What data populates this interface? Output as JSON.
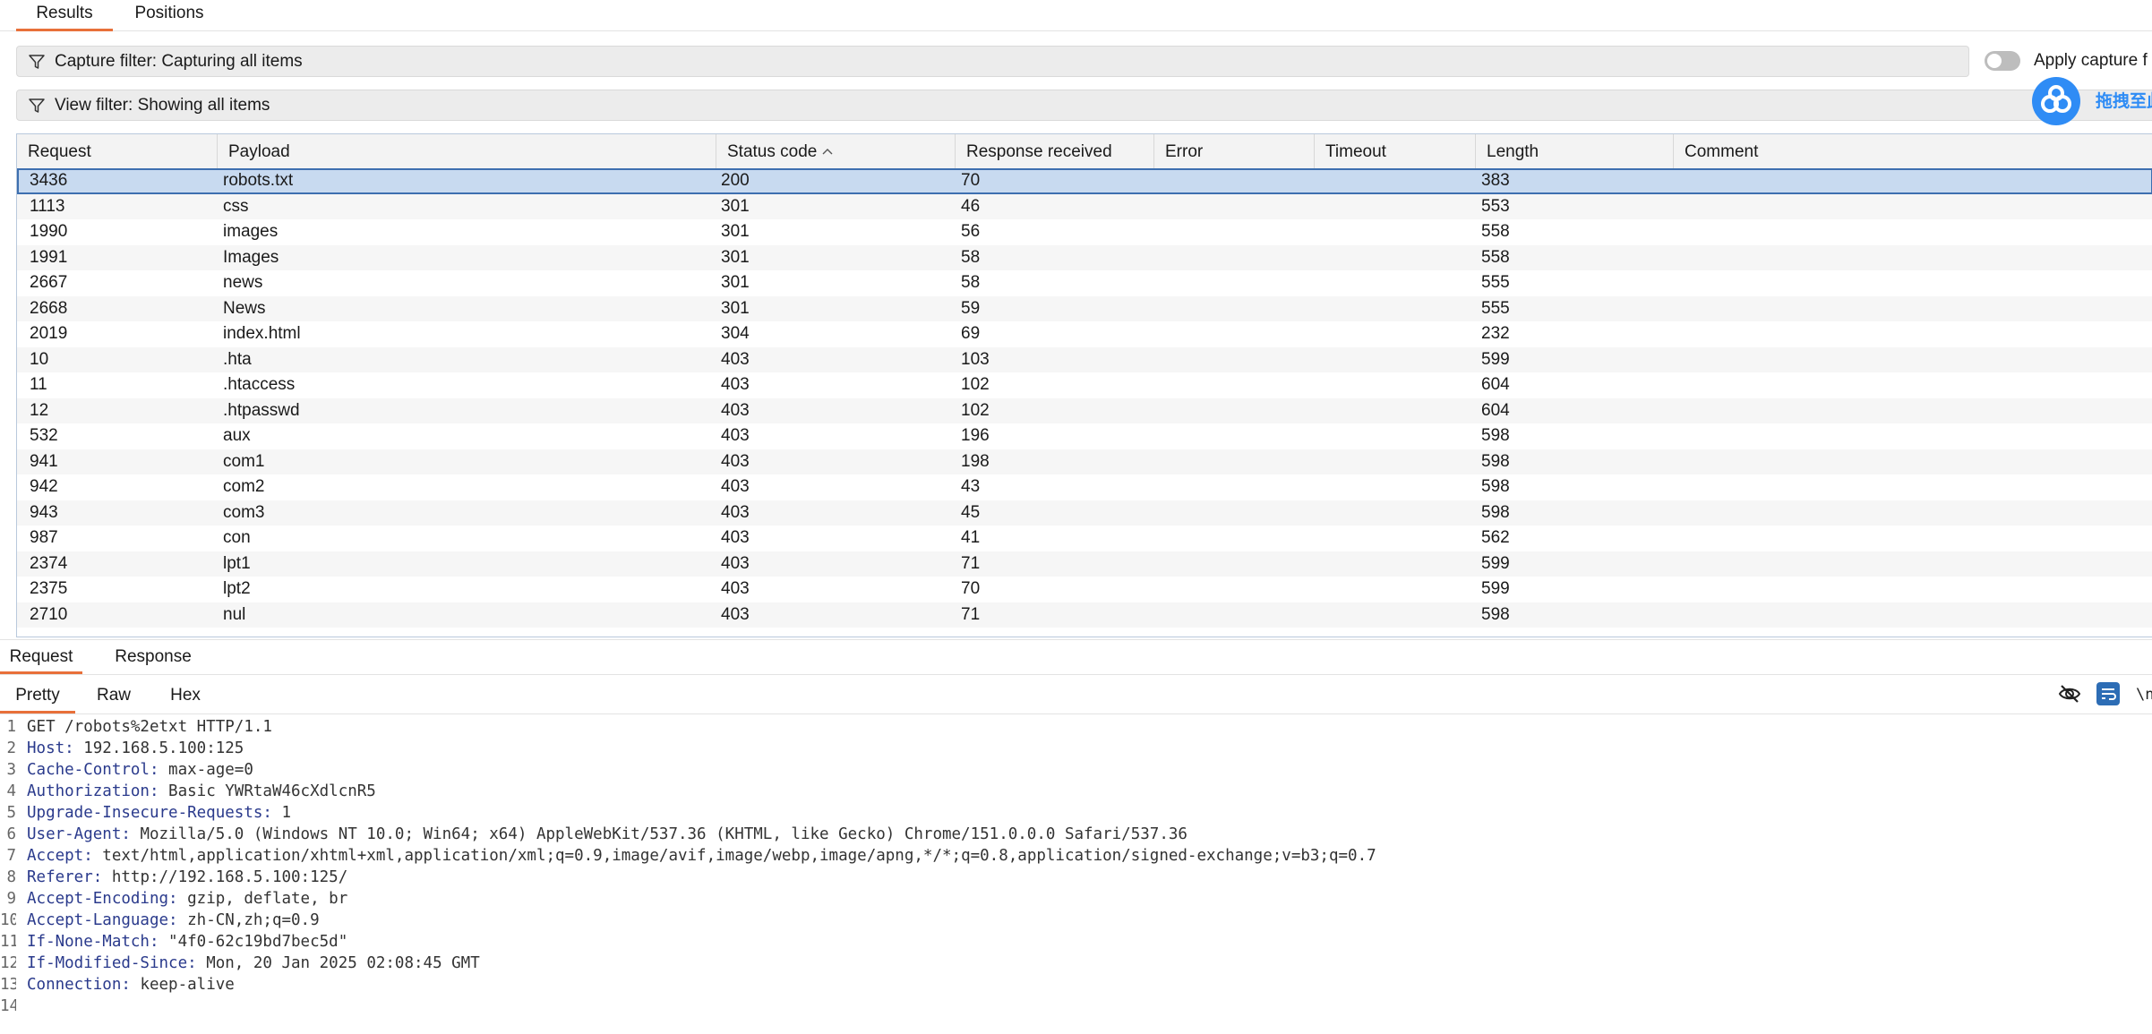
{
  "top_tabs": [
    "Results",
    "Positions"
  ],
  "capture_filter": "Capture filter: Capturing all items",
  "view_filter": "View filter: Showing all items",
  "apply_capture_label": "Apply capture f",
  "baidu_overlay_text": "拖拽至此",
  "table": {
    "columns": [
      "Request",
      "Payload",
      "Status code",
      "Response received",
      "Error",
      "Timeout",
      "Length",
      "Comment"
    ],
    "sorted_column": "Status code",
    "sort_direction": "ascending",
    "rows": [
      {
        "request": "3436",
        "payload": "robots.txt",
        "status": "200",
        "received": "70",
        "error": "",
        "timeout": "",
        "length": "383",
        "comment": "",
        "selected": true
      },
      {
        "request": "1113",
        "payload": "css",
        "status": "301",
        "received": "46",
        "error": "",
        "timeout": "",
        "length": "553",
        "comment": ""
      },
      {
        "request": "1990",
        "payload": "images",
        "status": "301",
        "received": "56",
        "error": "",
        "timeout": "",
        "length": "558",
        "comment": ""
      },
      {
        "request": "1991",
        "payload": "Images",
        "status": "301",
        "received": "58",
        "error": "",
        "timeout": "",
        "length": "558",
        "comment": ""
      },
      {
        "request": "2667",
        "payload": "news",
        "status": "301",
        "received": "58",
        "error": "",
        "timeout": "",
        "length": "555",
        "comment": ""
      },
      {
        "request": "2668",
        "payload": "News",
        "status": "301",
        "received": "59",
        "error": "",
        "timeout": "",
        "length": "555",
        "comment": ""
      },
      {
        "request": "2019",
        "payload": "index.html",
        "status": "304",
        "received": "69",
        "error": "",
        "timeout": "",
        "length": "232",
        "comment": ""
      },
      {
        "request": "10",
        "payload": ".hta",
        "status": "403",
        "received": "103",
        "error": "",
        "timeout": "",
        "length": "599",
        "comment": ""
      },
      {
        "request": "11",
        "payload": ".htaccess",
        "status": "403",
        "received": "102",
        "error": "",
        "timeout": "",
        "length": "604",
        "comment": ""
      },
      {
        "request": "12",
        "payload": ".htpasswd",
        "status": "403",
        "received": "102",
        "error": "",
        "timeout": "",
        "length": "604",
        "comment": ""
      },
      {
        "request": "532",
        "payload": "aux",
        "status": "403",
        "received": "196",
        "error": "",
        "timeout": "",
        "length": "598",
        "comment": ""
      },
      {
        "request": "941",
        "payload": "com1",
        "status": "403",
        "received": "198",
        "error": "",
        "timeout": "",
        "length": "598",
        "comment": ""
      },
      {
        "request": "942",
        "payload": "com2",
        "status": "403",
        "received": "43",
        "error": "",
        "timeout": "",
        "length": "598",
        "comment": ""
      },
      {
        "request": "943",
        "payload": "com3",
        "status": "403",
        "received": "45",
        "error": "",
        "timeout": "",
        "length": "598",
        "comment": ""
      },
      {
        "request": "987",
        "payload": "con",
        "status": "403",
        "received": "41",
        "error": "",
        "timeout": "",
        "length": "562",
        "comment": ""
      },
      {
        "request": "2374",
        "payload": "lpt1",
        "status": "403",
        "received": "71",
        "error": "",
        "timeout": "",
        "length": "599",
        "comment": ""
      },
      {
        "request": "2375",
        "payload": "lpt2",
        "status": "403",
        "received": "70",
        "error": "",
        "timeout": "",
        "length": "599",
        "comment": ""
      },
      {
        "request": "2710",
        "payload": "nul",
        "status": "403",
        "received": "71",
        "error": "",
        "timeout": "",
        "length": "598",
        "comment": ""
      }
    ]
  },
  "message_tabs": [
    "Request",
    "Response"
  ],
  "view_tabs": [
    "Pretty",
    "Raw",
    "Hex"
  ],
  "editor_icons": [
    "eye-slash-icon",
    "wrap-icon",
    "newline-icon"
  ],
  "request_lines": [
    {
      "num": "1",
      "key": "",
      "value": "GET /robots%2etxt HTTP/1.1"
    },
    {
      "num": "2",
      "key": "Host",
      "value": "192.168.5.100:125"
    },
    {
      "num": "3",
      "key": "Cache-Control",
      "value": "max-age=0"
    },
    {
      "num": "4",
      "key": "Authorization",
      "value": "Basic YWRtaW46cXdlcnR5"
    },
    {
      "num": "5",
      "key": "Upgrade-Insecure-Requests",
      "value": "1"
    },
    {
      "num": "6",
      "key": "User-Agent",
      "value": "Mozilla/5.0 (Windows NT 10.0; Win64; x64) AppleWebKit/537.36 (KHTML, like Gecko) Chrome/151.0.0.0 Safari/537.36"
    },
    {
      "num": "7",
      "key": "Accept",
      "value": "text/html,application/xhtml+xml,application/xml;q=0.9,image/avif,image/webp,image/apng,*/*;q=0.8,application/signed-exchange;v=b3;q=0.7"
    },
    {
      "num": "8",
      "key": "Referer",
      "value": "http://192.168.5.100:125/"
    },
    {
      "num": "9",
      "key": "Accept-Encoding",
      "value": "gzip, deflate, br"
    },
    {
      "num": "10",
      "key": "Accept-Language",
      "value": "zh-CN,zh;q=0.9"
    },
    {
      "num": "11",
      "key": "If-None-Match",
      "value": "\"4f0-62c19bd7bec5d\""
    },
    {
      "num": "12",
      "key": "If-Modified-Since",
      "value": "Mon, 20 Jan 2025 02:08:45 GMT"
    },
    {
      "num": "13",
      "key": "Connection",
      "value": "keep-alive"
    },
    {
      "num": "14",
      "key": "",
      "value": ""
    }
  ]
}
